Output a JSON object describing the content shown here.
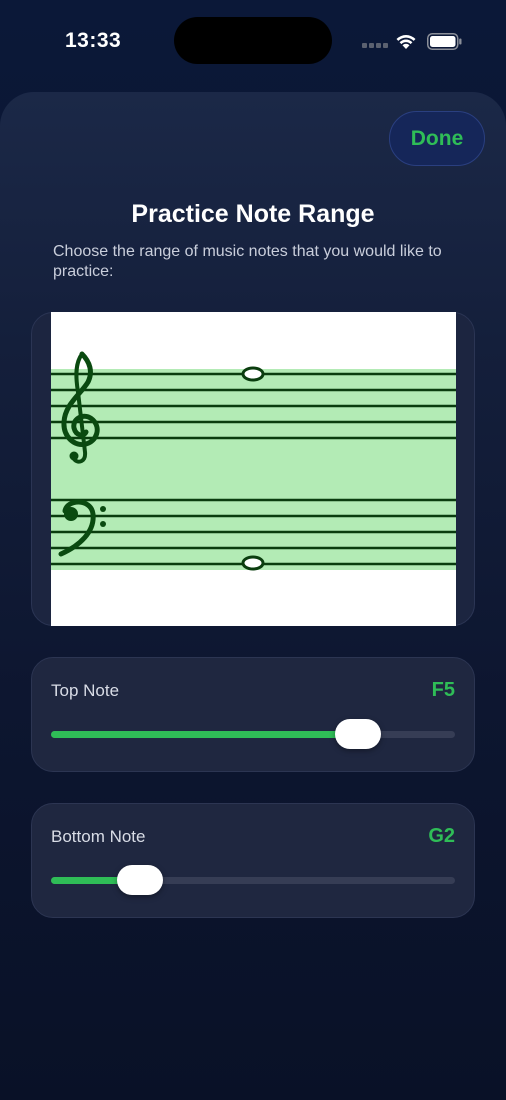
{
  "status_bar": {
    "time": "13:33"
  },
  "header": {
    "done_label": "Done",
    "title": "Practice Note Range",
    "subtitle": "Choose the range of music notes that you would like to practice:"
  },
  "staff": {
    "highlight_color": "#b3ebb5",
    "line_color": "#0a3d0e",
    "clef_color": "#0a4a10",
    "top_note": "F5",
    "bottom_note": "G2"
  },
  "top_note_slider": {
    "label": "Top Note",
    "value": "F5",
    "fraction": 0.76
  },
  "bottom_note_slider": {
    "label": "Bottom Note",
    "value": "G2",
    "fraction": 0.22
  },
  "colors": {
    "accent": "#2fbd57",
    "track": "#363d55"
  }
}
